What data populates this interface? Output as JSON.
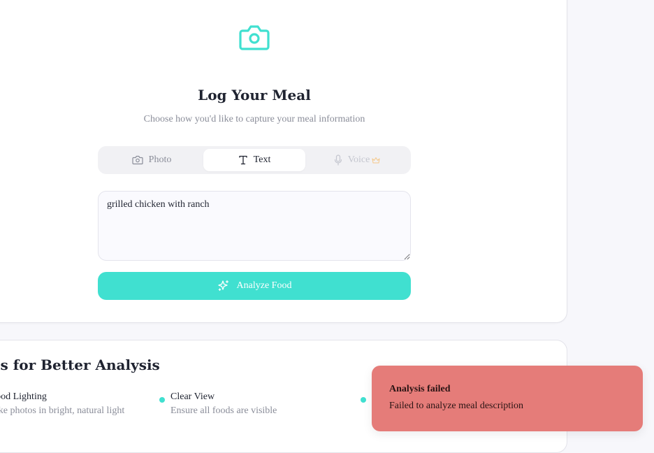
{
  "log_meal": {
    "title": "Log Your Meal",
    "subtitle": "Choose how you'd like to capture your meal information",
    "icon": "camera-icon",
    "accent_color": "#40e0d0"
  },
  "modes": {
    "photo_label": "Photo",
    "text_label": "Text",
    "voice_label": "Voice",
    "selected": "Text"
  },
  "meal_input": {
    "value": "grilled chicken with ranch"
  },
  "analyze_button": {
    "label": "Analyze Food"
  },
  "tips": {
    "title": "Tips for Better Analysis",
    "items": [
      {
        "title": "Good Lighting",
        "description": "Take photos in bright, natural light"
      },
      {
        "title": "Clear View",
        "description": "Ensure all foods are visible"
      }
    ]
  },
  "toast": {
    "title": "Analysis failed",
    "message": "Failed to analyze meal description",
    "color": "#e57c79"
  }
}
